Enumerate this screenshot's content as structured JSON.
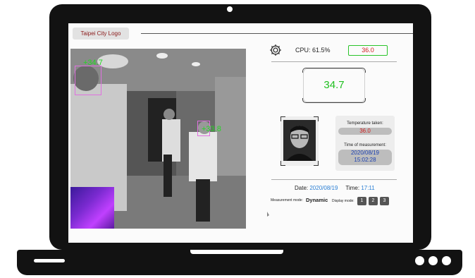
{
  "app": {
    "logo_text": "Taipei City Logo"
  },
  "camera_feed": {
    "detections": [
      {
        "temperature": "+34.7"
      },
      {
        "temperature": "+33.8"
      }
    ]
  },
  "status": {
    "cpu_label": "CPU: 61.5%",
    "alert_temperature": "36.0"
  },
  "main_reading": {
    "temperature": "34.7"
  },
  "measurement": {
    "temperature_taken_label": "Temperature taken:",
    "temperature_taken_value": "36.0",
    "time_label": "Time of measurement:",
    "time_date": "2020/08/19",
    "time_clock": "15:02:28"
  },
  "footer": {
    "date_label": "Date:",
    "date_value": "2020/08/19",
    "time_label": "Time:",
    "time_value": "17:11",
    "measurement_mode_label": "Measurement mode:",
    "measurement_mode_value": "Dynamic",
    "display_mode_label": "Display mode:",
    "display_mode_buttons": [
      "1",
      "2",
      "3"
    ]
  },
  "colors": {
    "reading_green": "#1fbf1f",
    "alert_red": "#d02020",
    "date_blue": "#2a7fd4",
    "face_box_magenta": "#e070e0"
  },
  "icons": {
    "settings": "gear-icon"
  }
}
